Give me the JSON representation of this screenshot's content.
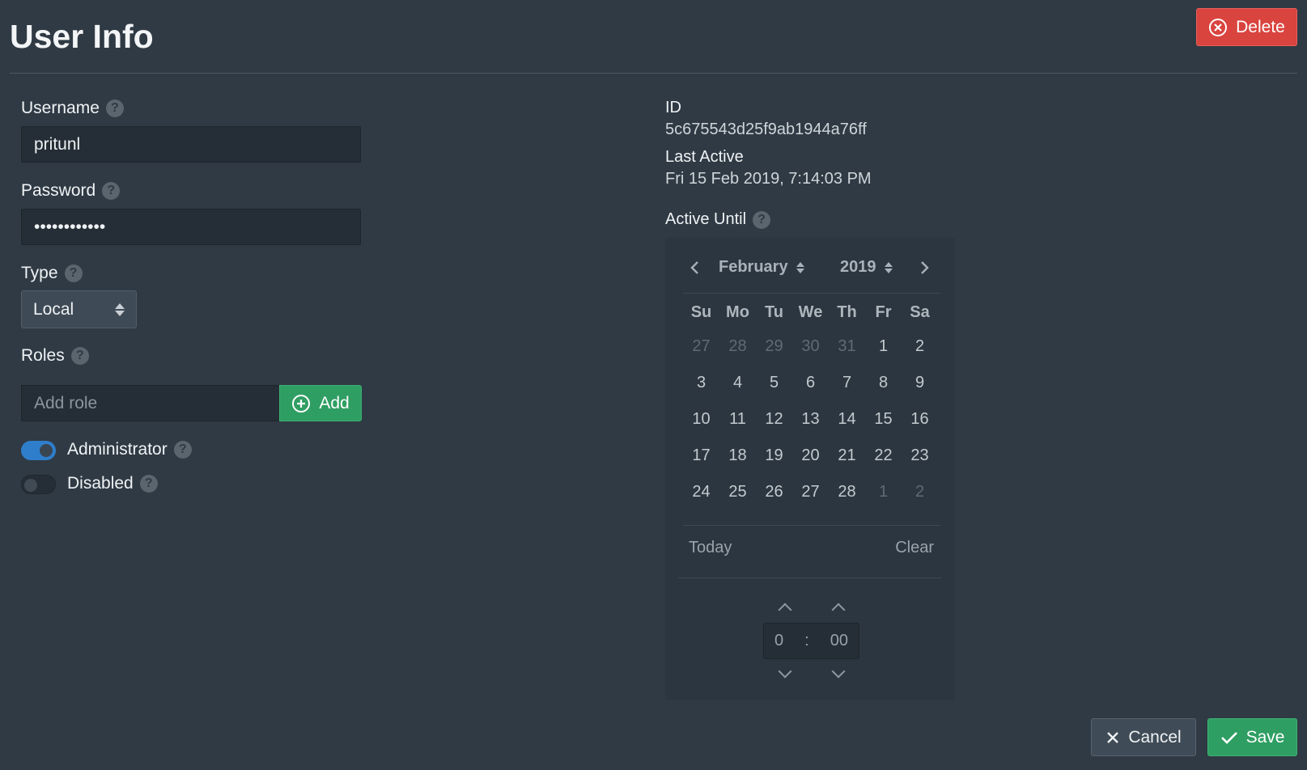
{
  "page": {
    "title": "User Info"
  },
  "buttons": {
    "delete": "Delete",
    "cancel": "Cancel",
    "save": "Save",
    "add": "Add"
  },
  "form": {
    "username": {
      "label": "Username",
      "value": "pritunl"
    },
    "password": {
      "label": "Password",
      "value": "••••••••••••"
    },
    "type": {
      "label": "Type",
      "value": "Local"
    },
    "roles": {
      "label": "Roles",
      "placeholder": "Add role"
    },
    "administrator": {
      "label": "Administrator",
      "on": true
    },
    "disabled": {
      "label": "Disabled",
      "on": false
    }
  },
  "info": {
    "id_label": "ID",
    "id_value": "5c675543d25f9ab1944a76ff",
    "last_active_label": "Last Active",
    "last_active_value": "Fri 15 Feb 2019, 7:14:03 PM",
    "active_until_label": "Active Until"
  },
  "calendar": {
    "month": "February",
    "year": "2019",
    "weekdays": [
      "Su",
      "Mo",
      "Tu",
      "We",
      "Th",
      "Fr",
      "Sa"
    ],
    "days": [
      {
        "d": "27",
        "muted": true
      },
      {
        "d": "28",
        "muted": true
      },
      {
        "d": "29",
        "muted": true
      },
      {
        "d": "30",
        "muted": true
      },
      {
        "d": "31",
        "muted": true
      },
      {
        "d": "1",
        "muted": false
      },
      {
        "d": "2",
        "muted": false
      },
      {
        "d": "3",
        "muted": false
      },
      {
        "d": "4",
        "muted": false
      },
      {
        "d": "5",
        "muted": false
      },
      {
        "d": "6",
        "muted": false
      },
      {
        "d": "7",
        "muted": false
      },
      {
        "d": "8",
        "muted": false
      },
      {
        "d": "9",
        "muted": false
      },
      {
        "d": "10",
        "muted": false
      },
      {
        "d": "11",
        "muted": false
      },
      {
        "d": "12",
        "muted": false
      },
      {
        "d": "13",
        "muted": false
      },
      {
        "d": "14",
        "muted": false
      },
      {
        "d": "15",
        "muted": false
      },
      {
        "d": "16",
        "muted": false
      },
      {
        "d": "17",
        "muted": false
      },
      {
        "d": "18",
        "muted": false
      },
      {
        "d": "19",
        "muted": false
      },
      {
        "d": "20",
        "muted": false
      },
      {
        "d": "21",
        "muted": false
      },
      {
        "d": "22",
        "muted": false
      },
      {
        "d": "23",
        "muted": false
      },
      {
        "d": "24",
        "muted": false
      },
      {
        "d": "25",
        "muted": false
      },
      {
        "d": "26",
        "muted": false
      },
      {
        "d": "27",
        "muted": false
      },
      {
        "d": "28",
        "muted": false
      },
      {
        "d": "1",
        "muted": true
      },
      {
        "d": "2",
        "muted": true
      }
    ],
    "today": "Today",
    "clear": "Clear",
    "hour": "0",
    "sep": ":",
    "minute": "00"
  },
  "colors": {
    "background": "#2f3a44",
    "danger": "#d9443f",
    "success": "#2f9e63",
    "toggle_on": "#2f7ecb"
  },
  "icons": {
    "help": "?"
  }
}
